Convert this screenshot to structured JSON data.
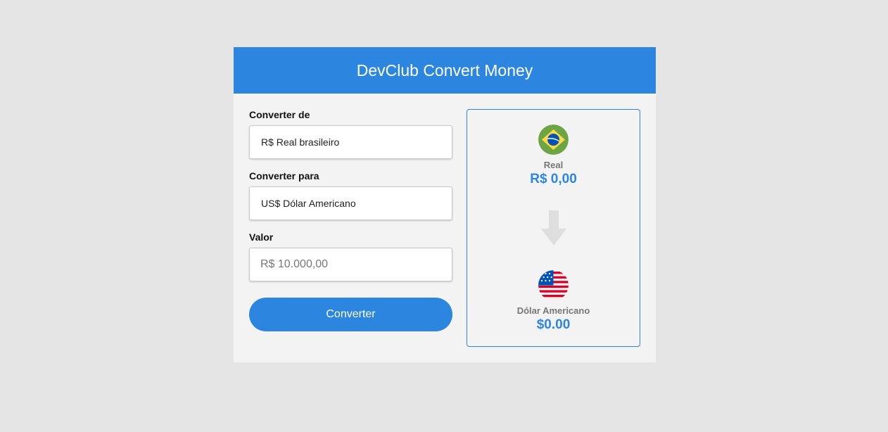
{
  "app": {
    "title": "DevClub Convert Money"
  },
  "form": {
    "from_label": "Converter de",
    "from_value": "R$ Real brasileiro",
    "to_label": "Converter para",
    "to_value": "US$ Dólar Americano",
    "value_label": "Valor",
    "value_placeholder": "R$ 10.000,00",
    "convert_label": "Converter"
  },
  "result": {
    "from": {
      "flag_icon": "brazil-flag-icon",
      "name": "Real",
      "value": "R$ 0,00"
    },
    "arrow_icon": "arrow-down-icon",
    "to": {
      "flag_icon": "usa-flag-icon",
      "name": "Dólar Americano",
      "value": "$0.00"
    }
  },
  "colors": {
    "accent": "#2c86e0",
    "page_background": "#e5e5e5",
    "card_background": "#f3f3f3",
    "muted_text": "#777777"
  }
}
